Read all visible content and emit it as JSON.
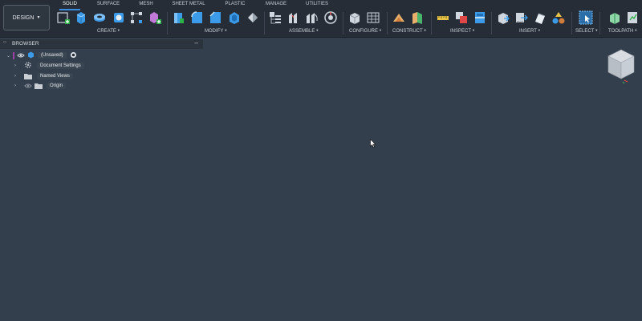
{
  "workspace": {
    "label": "DESIGN"
  },
  "tabs": [
    "SOLID",
    "SURFACE",
    "MESH",
    "SHEET METAL",
    "PLASTIC",
    "MANAGE",
    "UTILITIES"
  ],
  "groups": {
    "create": "CREATE",
    "modify": "MODIFY",
    "assemble": "ASSEMBLE",
    "configure": "CONFIGURE",
    "construct": "CONSTRUCT",
    "inspect": "INSPECT",
    "insert": "INSERT",
    "select": "SELECT",
    "toolpath": "TOOLPATH"
  },
  "browser": {
    "title": "BROWSER",
    "root": "(Unsaved)",
    "items": [
      "Document Settings",
      "Named Views",
      "Origin"
    ]
  },
  "colors": {
    "canvas": "#333f4d",
    "toolbar": "#262d36",
    "accent_blue": "#3b8fe0",
    "root_marker": "#a03ea8"
  },
  "icons": {
    "create": [
      "sketch-icon",
      "extrude-icon",
      "revolve-icon",
      "hole-icon",
      "pattern-icon",
      "new-component-icon"
    ],
    "modify": [
      "press-pull-icon",
      "fillet-icon",
      "chamfer-icon",
      "shell-icon",
      "combine-icon"
    ],
    "assemble": [
      "new-component-icon",
      "joint-icon",
      "as-built-joint-icon",
      "motion-icon"
    ],
    "configure": [
      "configure-icon",
      "table-icon"
    ],
    "construct": [
      "offset-plane-icon",
      "plane-at-angle-icon"
    ],
    "inspect": [
      "measure-icon",
      "interference-icon",
      "section-analysis-icon"
    ],
    "insert": [
      "insert-derive-icon",
      "insert-mesh-icon",
      "decal-icon",
      "insert-svg-icon"
    ],
    "select": [
      "select-icon"
    ],
    "toolpath": [
      "toolpath-icon",
      "toolpath-simulate-icon"
    ]
  }
}
